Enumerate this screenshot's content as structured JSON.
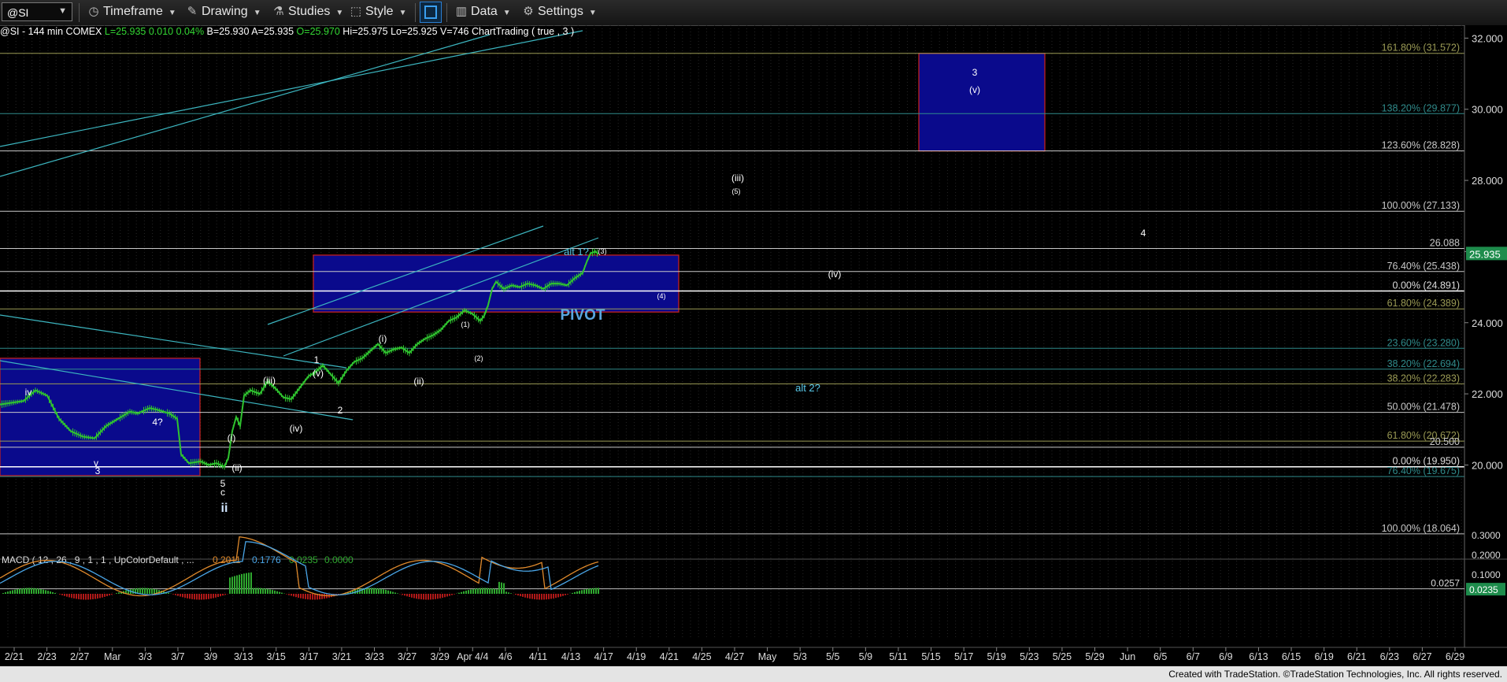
{
  "toolbar": {
    "symbol": "@SI",
    "items": [
      {
        "label": "Timeframe",
        "icon": "clock-icon"
      },
      {
        "label": "Drawing",
        "icon": "pencil-icon"
      },
      {
        "label": "Studies",
        "icon": "flask-icon"
      },
      {
        "label": "Style",
        "icon": "style-icon"
      },
      {
        "label": "Data",
        "icon": "bar-chart-icon"
      },
      {
        "label": "Settings",
        "icon": "gear-icon"
      }
    ]
  },
  "info_line": {
    "prefix": "@SI - 144 min  COMEX  ",
    "last": "L=25.935",
    "change": "0.010",
    "pct": "0.04%",
    "rest": "B=25.930  A=25.935  ",
    "open": "O=25.970",
    "ohlc_rest": "Hi=25.975  Lo=25.925  V=746  ChartTrading ( true , 3 )"
  },
  "footer": "Created with TradeStation. ©TradeStation Technologies, Inc. All rights reserved.",
  "chart_data": [
    {
      "type": "line",
      "title": "@SI - 144 min COMEX",
      "price_axis": [
        32,
        30,
        28,
        26,
        24,
        22,
        20
      ],
      "price_axis_labels": [
        "32.000",
        "30.000",
        "28.000",
        "26.000",
        "24.000",
        "22.000",
        "20.000"
      ],
      "last_price": "25.935",
      "x_labels": [
        "2/21",
        "2/23",
        "2/27",
        "Mar",
        "3/3",
        "3/7",
        "3/9",
        "3/13",
        "3/15",
        "3/17",
        "3/21",
        "3/23",
        "3/27",
        "3/29",
        "Apr 4/4",
        "4/6",
        "4/11",
        "4/13",
        "4/17",
        "4/19",
        "4/21",
        "4/25",
        "4/27",
        "May",
        "5/3",
        "5/5",
        "5/9",
        "5/11",
        "5/15",
        "5/17",
        "5/19",
        "5/23",
        "5/25",
        "5/29",
        "Jun",
        "6/5",
        "6/7",
        "6/9",
        "6/13",
        "6/15",
        "6/19",
        "6/21",
        "6/23",
        "6/27",
        "6/29"
      ],
      "fib_levels": [
        {
          "label": "161.80% (31.572)",
          "value": 31.572,
          "color": "#9a9a54"
        },
        {
          "label": "138.20% (29.877)",
          "value": 29.877,
          "color": "#2f8a8a"
        },
        {
          "label": "123.60% (28.828)",
          "value": 28.828,
          "color": "#c8c8c8"
        },
        {
          "label": "100.00% (27.133)",
          "value": 27.133,
          "color": "#c8c8c8"
        },
        {
          "label": "26.088",
          "value": 26.088,
          "color": "#c8c8c8"
        },
        {
          "label": "76.40% (25.438)",
          "value": 25.438,
          "color": "#c8c8c8"
        },
        {
          "label": "0.00% (24.891)",
          "value": 24.891,
          "color": "#ffffff"
        },
        {
          "label": "61.80% (24.389)",
          "value": 24.389,
          "color": "#9a9a54"
        },
        {
          "label": "23.60% (23.280)",
          "value": 23.28,
          "color": "#2f8a8a"
        },
        {
          "label": "38.20% (22.694)",
          "value": 22.694,
          "color": "#2f8a8a"
        },
        {
          "label": "38.20% (22.283)",
          "value": 22.283,
          "color": "#9a9a54"
        },
        {
          "label": "50.00% (21.478)",
          "value": 21.478,
          "color": "#c8c8c8"
        },
        {
          "label": "61.80% (20.672)",
          "value": 20.672,
          "color": "#9a9a54"
        },
        {
          "label": "20.500",
          "value": 20.5,
          "color": "#c8c8c8"
        },
        {
          "label": "0.00% (19.950)",
          "value": 19.95,
          "color": "#ffffff"
        },
        {
          "label": "76.40% (19.675)",
          "value": 19.675,
          "color": "#2f8a8a"
        },
        {
          "label": "100.00% (18.064)",
          "value": 18.064,
          "color": "#c8c8c8"
        }
      ],
      "annotations": [
        "iv",
        "4?",
        "v",
        "3",
        "(i)",
        "(ii)",
        "5",
        "c",
        "ii",
        "(iii)",
        "1",
        "(v)",
        "(iv)",
        "2",
        "(i)",
        "(ii)",
        "(1)",
        "(2)",
        "alt 1?",
        "(3)",
        "(4)",
        "PIVOT",
        "(iii)",
        "(5)",
        "(iv)",
        "3",
        "(v)",
        "4",
        "alt 2?"
      ],
      "price_series": [
        [
          0,
          21.7
        ],
        [
          30,
          21.8
        ],
        [
          45,
          22.1
        ],
        [
          60,
          21.95
        ],
        [
          75,
          21.3
        ],
        [
          90,
          20.95
        ],
        [
          105,
          20.8
        ],
        [
          120,
          20.75
        ],
        [
          135,
          21.1
        ],
        [
          150,
          21.3
        ],
        [
          165,
          21.5
        ],
        [
          175,
          21.45
        ],
        [
          190,
          21.6
        ],
        [
          200,
          21.55
        ],
        [
          215,
          21.45
        ],
        [
          225,
          21.3
        ],
        [
          230,
          20.3
        ],
        [
          240,
          20.05
        ],
        [
          255,
          20.1
        ],
        [
          265,
          20.0
        ],
        [
          275,
          20.05
        ],
        [
          285,
          19.95
        ],
        [
          290,
          20.2
        ],
        [
          295,
          20.95
        ],
        [
          300,
          21.35
        ],
        [
          305,
          21.1
        ],
        [
          310,
          21.95
        ],
        [
          318,
          22.1
        ],
        [
          330,
          22.0
        ],
        [
          340,
          22.35
        ],
        [
          350,
          22.15
        ],
        [
          360,
          21.9
        ],
        [
          370,
          21.85
        ],
        [
          380,
          22.15
        ],
        [
          392,
          22.5
        ],
        [
          400,
          22.6
        ],
        [
          410,
          22.8
        ],
        [
          420,
          22.55
        ],
        [
          430,
          22.3
        ],
        [
          440,
          22.65
        ],
        [
          450,
          22.9
        ],
        [
          460,
          23.0
        ],
        [
          470,
          23.2
        ],
        [
          480,
          23.4
        ],
        [
          490,
          23.15
        ],
        [
          500,
          23.25
        ],
        [
          510,
          23.3
        ],
        [
          520,
          23.15
        ],
        [
          530,
          23.4
        ],
        [
          540,
          23.55
        ],
        [
          550,
          23.65
        ],
        [
          560,
          23.8
        ],
        [
          570,
          24.05
        ],
        [
          580,
          24.15
        ],
        [
          590,
          24.35
        ],
        [
          600,
          24.25
        ],
        [
          610,
          24.05
        ],
        [
          615,
          24.2
        ],
        [
          620,
          24.5
        ],
        [
          625,
          24.95
        ],
        [
          630,
          25.15
        ],
        [
          640,
          24.95
        ],
        [
          650,
          25.05
        ],
        [
          660,
          25.0
        ],
        [
          670,
          25.1
        ],
        [
          680,
          25.05
        ],
        [
          690,
          24.95
        ],
        [
          700,
          25.1
        ],
        [
          710,
          25.1
        ],
        [
          720,
          25.05
        ],
        [
          730,
          25.25
        ],
        [
          740,
          25.4
        ],
        [
          745,
          25.7
        ],
        [
          750,
          25.95
        ],
        [
          756,
          26.0
        ],
        [
          760,
          25.935
        ]
      ],
      "pivot_zone": {
        "top": 25.9,
        "bottom": 24.3
      },
      "target_zone": {
        "top": 31.572,
        "bottom": 28.828
      },
      "left_zone": {
        "top": 23.0,
        "bottom": 19.7
      }
    },
    {
      "type": "bar",
      "title": "MACD ( 12 , 26 , 9 , 1 , 1 , UpColorDefault , ...",
      "readouts": [
        "0.2011",
        "0.1776",
        "0.0235",
        "0.0000"
      ],
      "axis_labels": [
        "0.3000",
        "0.2000",
        "0.1000",
        "0.0257",
        "0.0235"
      ],
      "ylim": [
        -0.05,
        0.35
      ]
    }
  ],
  "colors": {
    "price_bars": "#2fc42f",
    "channel": "#3cb6c0",
    "zone_fill": "#0a0a8c",
    "zone_border": "#c02020",
    "last_price_bg": "#1e8c4c",
    "macd_orange": "#e08a2c",
    "macd_blue": "#4aa6e8",
    "hist_up": "#2fa82f",
    "hist_down": "#b01818"
  }
}
